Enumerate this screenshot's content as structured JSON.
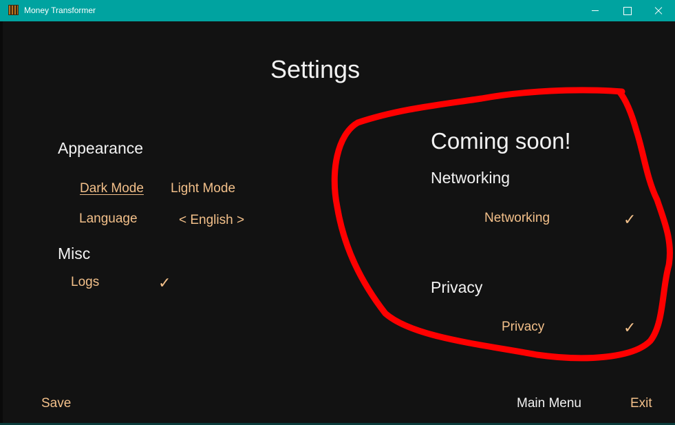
{
  "window": {
    "title": "Money Transformer",
    "icon": "app-icon",
    "controls": [
      "minimize-icon",
      "maximize-icon",
      "close-icon"
    ]
  },
  "page": {
    "title": "Settings"
  },
  "appearance": {
    "heading": "Appearance",
    "dark_mode": "Dark Mode",
    "light_mode": "Light Mode",
    "selected_theme": "Dark Mode",
    "language_label": "Language",
    "language_value": "< English >"
  },
  "misc": {
    "heading": "Misc",
    "logs_label": "Logs",
    "logs_check": "✓"
  },
  "coming_soon": {
    "title": "Coming soon!",
    "networking_heading": "Networking",
    "networking_label": "Networking",
    "networking_check": "✓",
    "privacy_heading": "Privacy",
    "privacy_label": "Privacy",
    "privacy_check": "✓"
  },
  "footer": {
    "save": "Save",
    "main_menu": "Main Menu",
    "exit": "Exit"
  },
  "colors": {
    "titlebar": "#00a3a0",
    "background": "#121212",
    "accent_text": "#f3c08a",
    "heading_text": "#f2f2f2",
    "annotation": "#ff0000"
  }
}
